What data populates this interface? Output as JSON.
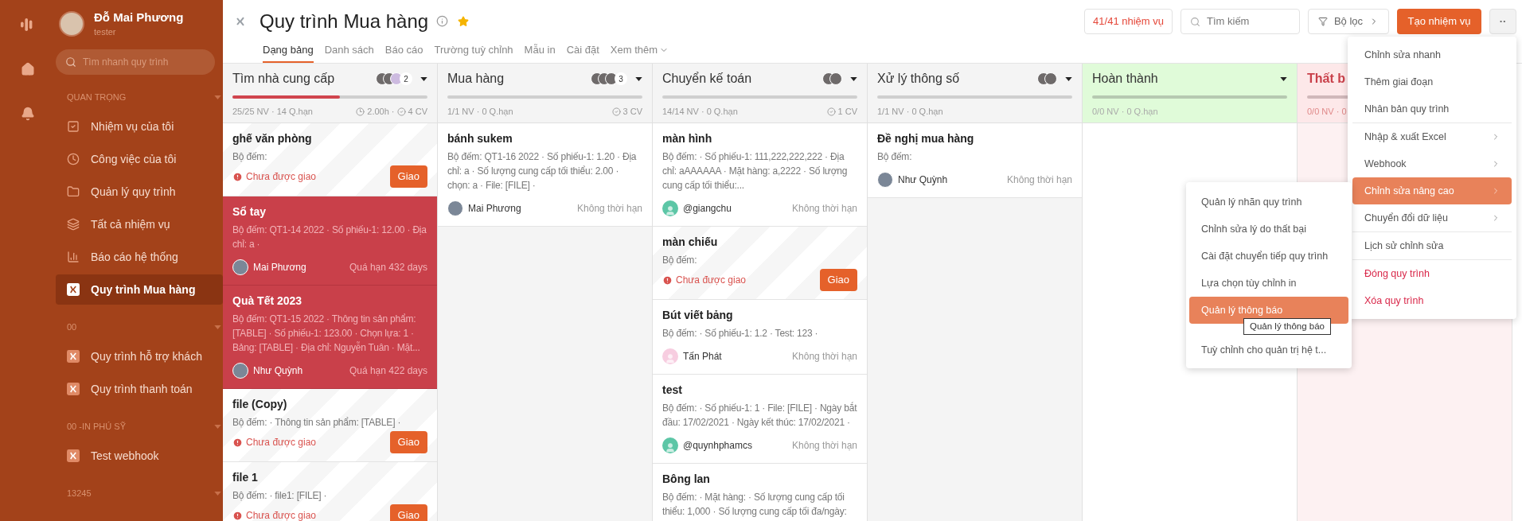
{
  "user": {
    "name": "Đỗ Mai Phương",
    "role": "tester"
  },
  "sidebar": {
    "search": {
      "placeholder": "Tìm nhanh quy trình"
    },
    "sections": [
      {
        "title": "QUAN TRỌNG",
        "items": [
          {
            "label": "Nhiệm vụ của tôi",
            "selected": false
          },
          {
            "label": "Công việc của tôi",
            "selected": false
          },
          {
            "label": "Quản lý quy trình",
            "selected": false
          },
          {
            "label": "Tất cả nhiệm vụ",
            "selected": false
          },
          {
            "label": "Báo cáo hệ thống",
            "selected": false
          },
          {
            "label": "Quy trình Mua hàng",
            "selected": true
          }
        ]
      },
      {
        "title": "00",
        "items": [
          {
            "label": "Quy trình hỗ trợ khách",
            "selected": false
          },
          {
            "label": "Quy trình thanh toán",
            "selected": false
          }
        ]
      },
      {
        "title": "00 -IN PHÚ SỸ",
        "items": [
          {
            "label": "Test webhook",
            "selected": false
          }
        ]
      },
      {
        "title": "13245"
      }
    ]
  },
  "header": {
    "title": "Quy trình Mua hàng",
    "starred": true,
    "tabs": [
      {
        "label": "Dạng bảng",
        "selected": true
      },
      {
        "label": "Danh sách",
        "selected": false
      },
      {
        "label": "Báo cáo",
        "selected": false
      },
      {
        "label": "Trường tuỳ chỉnh",
        "selected": false
      },
      {
        "label": "Mẫu in",
        "selected": false
      },
      {
        "label": "Cài đặt",
        "selected": false
      },
      {
        "label": "Xem thêm",
        "selected": false,
        "dropdown": true
      }
    ],
    "task_count": "41/41 nhiệm vụ",
    "search": {
      "placeholder": "Tìm kiếm"
    },
    "filter": "Bộ lọc",
    "create": "Tạo nhiệm vụ",
    "more": "··"
  },
  "columns": [
    {
      "title": "Tìm nhà cung cấp",
      "kind": "normal",
      "avatars": [
        {
          "kind": "photo"
        },
        {
          "kind": "photo"
        },
        {
          "kind": "default"
        }
      ],
      "avatar_count": "2",
      "level": 0.55,
      "stats": "25/25 NV · 14 Q.hạn",
      "hours": "2.00h ·",
      "cv": "4 CV",
      "cards": [
        {
          "kind": "unassigned",
          "title": "ghế văn phòng",
          "details": "Bộ đếm:",
          "warning": "Chưa được giao",
          "action": "Giao"
        },
        {
          "kind": "overdue",
          "title": "Sổ tay",
          "details": "Bộ đếm: QT1-14 2022 · Số phiếu-1: 12.00 · Địa chỉ: a ·",
          "assignee": {
            "name": "Mai Phương"
          },
          "due": "Quá hạn 432 days"
        },
        {
          "kind": "overdue",
          "title": "Quà Tết 2023",
          "details": "Bộ đếm: QT1-15 2022 · Thông tin sản phẩm: [TABLE] · Số phiếu-1: 123.00 · Chọn lựa: 1 · Bảng: [TABLE] · Địa chỉ: Nguyễn Tuân · Mặt...",
          "assignee": {
            "name": "Như Quỳnh"
          },
          "due": "Quá hạn 422 days"
        },
        {
          "kind": "unassigned",
          "title": "file (Copy)",
          "details": "Bộ đếm: · Thông tin sản phẩm: [TABLE] ·",
          "warning": "Chưa được giao",
          "action": "Giao"
        },
        {
          "kind": "unassigned",
          "title": "file 1",
          "details": "Bộ đếm: · file1: [FILE] ·",
          "warning": "Chưa được giao",
          "action": "Giao"
        }
      ]
    },
    {
      "title": "Mua hàng",
      "kind": "normal",
      "avatars": [
        {
          "kind": "photo"
        },
        {
          "kind": "photo"
        },
        {
          "kind": "photo"
        }
      ],
      "avatar_count": "3",
      "stats": "1/1 NV · 0 Q.hạn",
      "cv": "3 CV",
      "cards": [
        {
          "kind": "assigned",
          "title": "bánh sukem",
          "details": "Bộ đếm: QT1-16 2022 · Số phiếu-1: 1.20 · Địa chỉ: a · Số lượng cung cấp tối thiểu: 2.00 · chọn: a · File: [FILE] ·",
          "assignee": {
            "name": "Mai Phương"
          },
          "due": "Không thời hạn"
        }
      ]
    },
    {
      "title": "Chuyển kế toán",
      "kind": "normal",
      "avatars": [
        {
          "kind": "photo"
        },
        {
          "kind": "photo"
        }
      ],
      "stats": "14/14 NV · 0 Q.hạn",
      "cv": "1 CV",
      "cards": [
        {
          "kind": "assigned",
          "title": "màn hình",
          "details": "Bộ đếm: · Số phiếu-1: 111,222,222,222 · Địa chỉ: aAAAAAA · Mặt hàng: a,2222 · Số lượng cung cấp tối thiểu:...",
          "assignee": {
            "name": "@giangchu",
            "color": "#5cc6a6"
          },
          "due": "Không thời hạn"
        },
        {
          "kind": "unassigned",
          "title": "màn chiếu",
          "details": "Bộ đếm:",
          "warning": "Chưa được giao",
          "action": "Giao"
        },
        {
          "kind": "assigned",
          "title": "Bút viết bảng",
          "details": "Bộ đếm: · Số phiếu-1: 1.2 · Test: 123 ·",
          "assignee": {
            "name": "Tấn Phát",
            "color": "#f7cde0"
          },
          "due": "Không thời hạn"
        },
        {
          "kind": "assigned",
          "title": "test",
          "details": "Bộ đếm: · Số phiếu-1: 1 · File: [FILE] · Ngày bắt đầu: 17/02/2021 · Ngày kết thúc: 17/02/2021 ·",
          "assignee": {
            "name": "@quynhphamcs",
            "color": "#5cc6a6"
          },
          "due": "Không thời hạn"
        },
        {
          "kind": "assigned",
          "title": "Bông lan",
          "details": "Bộ đếm: · Mặt hàng: · Số lượng cung cấp tối thiểu: 1,000 · Số lượng cung cấp tối đa/ngày:"
        }
      ]
    },
    {
      "title": "Xử lý thông số",
      "kind": "normal",
      "avatars": [
        {
          "kind": "photo"
        },
        {
          "kind": "photo"
        }
      ],
      "stats": "1/1 NV · 0 Q.hạn",
      "cards": [
        {
          "kind": "assigned",
          "title": "Đề nghị mua hàng",
          "details": "Bộ đếm:",
          "assignee": {
            "name": "Như Quỳnh"
          },
          "due": "Không thời hạn"
        }
      ]
    },
    {
      "title": "Hoàn thành",
      "kind": "done",
      "stats": "0/0 NV · 0 Q.hạn"
    },
    {
      "title": "Thất b",
      "kind": "failed",
      "stats": "0/0 NV · 0"
    }
  ],
  "menu": {
    "groups": [
      [
        {
          "label": "Chỉnh sửa nhanh",
          "submenu": false,
          "danger": false,
          "selected": false
        },
        {
          "label": "Thêm giai đoạn",
          "submenu": false,
          "danger": false,
          "selected": false
        },
        {
          "label": "Nhân bản quy trình",
          "submenu": false,
          "danger": false,
          "selected": false
        }
      ],
      [
        {
          "label": "Nhập & xuất Excel",
          "submenu": true,
          "danger": false,
          "selected": false
        },
        {
          "label": "Webhook",
          "submenu": true,
          "danger": false,
          "selected": false
        },
        {
          "label": "Chỉnh sửa nâng cao",
          "submenu": true,
          "danger": false,
          "selected": true
        },
        {
          "label": "Chuyển đổi dữ liệu",
          "submenu": true,
          "danger": false,
          "selected": false
        }
      ],
      [
        {
          "label": "Lịch sử chỉnh sửa",
          "submenu": false,
          "danger": false,
          "selected": false
        }
      ],
      [
        {
          "label": "Đóng quy trình",
          "submenu": false,
          "danger": true,
          "selected": false
        },
        {
          "label": "Xóa quy trình",
          "submenu": false,
          "danger": true,
          "selected": false
        }
      ]
    ]
  },
  "submenu": {
    "items": [
      {
        "label": "Quản lý nhãn quy trình",
        "selected": false
      },
      {
        "label": "Chỉnh sửa lý do thất bại",
        "selected": false
      },
      {
        "label": "Cài đặt chuyển tiếp quy trình",
        "selected": false
      },
      {
        "label": "Lựa chọn tùy chỉnh in",
        "selected": false
      },
      {
        "label": "Quản lý thông báo",
        "selected": true
      },
      {
        "label": "Tuỳ chỉnh cho quản trị hệ t...",
        "selected": false
      }
    ],
    "tooltip": "Quản lý thông báo"
  }
}
